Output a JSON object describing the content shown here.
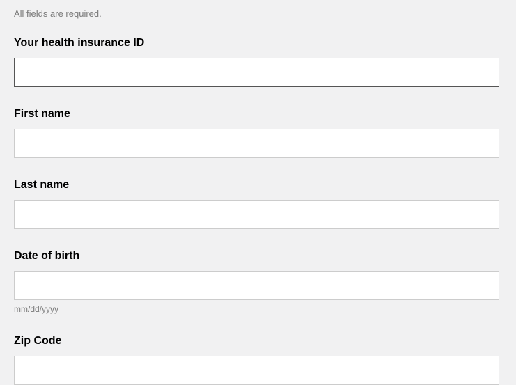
{
  "helper": "All fields are required.",
  "fields": {
    "insurance": {
      "label": "Your health insurance ID",
      "value": ""
    },
    "firstName": {
      "label": "First name",
      "value": ""
    },
    "lastName": {
      "label": "Last name",
      "value": ""
    },
    "dob": {
      "label": "Date of birth",
      "value": "",
      "hint": "mm/dd/yyyy"
    },
    "zip": {
      "label": "Zip Code",
      "value": ""
    }
  }
}
